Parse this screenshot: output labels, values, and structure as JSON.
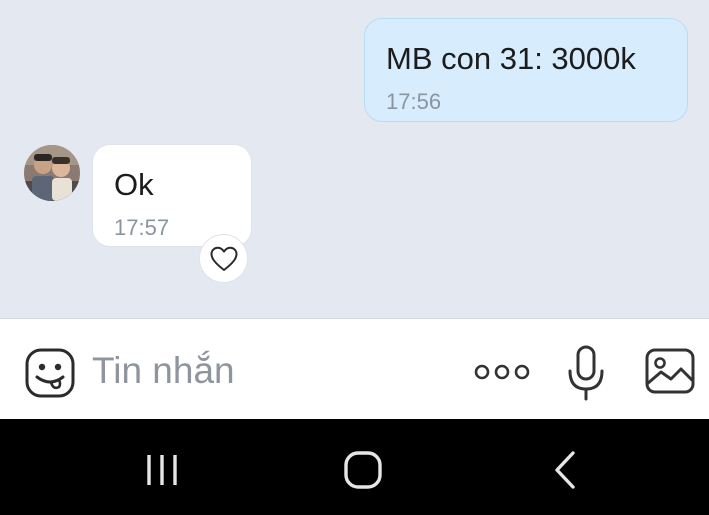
{
  "messages": [
    {
      "direction": "outgoing",
      "text": "MB con 31: 3000k",
      "time": "17:56"
    },
    {
      "direction": "incoming",
      "text": "Ok",
      "time": "17:57"
    }
  ],
  "composer": {
    "placeholder": "Tin nhắn",
    "value": ""
  },
  "icons": {
    "sticker": "sticker-icon",
    "more": "more-options-icon",
    "mic": "microphone-icon",
    "image": "image-icon",
    "react": "heart-icon",
    "nav_recents": "recents-icon",
    "nav_home": "home-icon",
    "nav_back": "back-icon"
  },
  "colors": {
    "chat_background": "#e3e8f1",
    "outgoing_bubble": "#d7edfd",
    "incoming_bubble": "#ffffff",
    "timestamp": "#8b959f",
    "nav_bar": "#000000"
  }
}
